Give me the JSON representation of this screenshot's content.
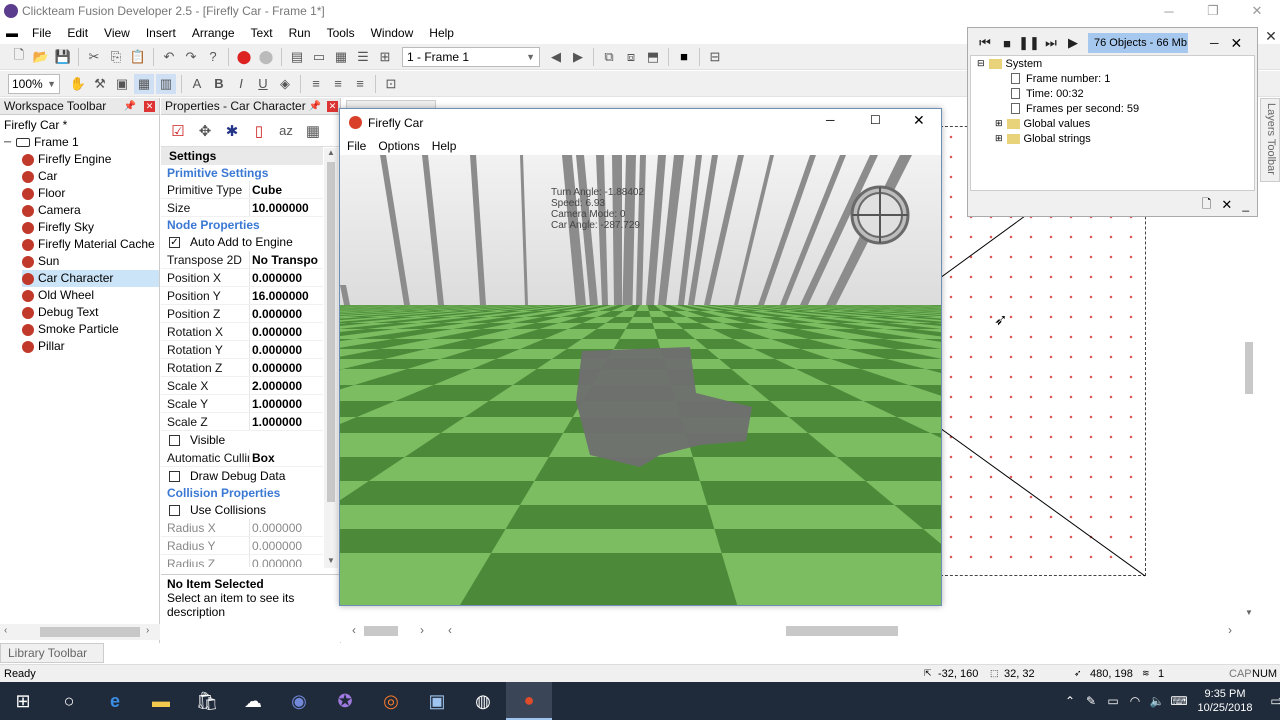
{
  "app": {
    "title": "Clickteam Fusion Developer 2.5 - [Firefly Car - Frame 1*]",
    "menu": [
      "File",
      "Edit",
      "View",
      "Insert",
      "Arrange",
      "Text",
      "Run",
      "Tools",
      "Window",
      "Help"
    ]
  },
  "toolbar": {
    "frame_select": "1 - Frame 1",
    "zoom": "100%"
  },
  "workspace": {
    "title": "Workspace Toolbar",
    "root": "Firefly Car *",
    "frame": "Frame 1",
    "items": [
      {
        "label": "Firefly Engine",
        "color": "#c0392b"
      },
      {
        "label": "Car",
        "color": "#c0392b"
      },
      {
        "label": "Floor",
        "color": "#c0392b"
      },
      {
        "label": "Camera",
        "color": "#c0392b"
      },
      {
        "label": "Firefly Sky",
        "color": "#c0392b"
      },
      {
        "label": "Firefly Material Cache",
        "color": "#c0392b"
      },
      {
        "label": "Sun",
        "color": "#c0392b"
      },
      {
        "label": "Car Character",
        "color": "#c0392b"
      },
      {
        "label": "Old Wheel",
        "color": "#c0392b"
      },
      {
        "label": "Debug Text",
        "color": "#c0392b"
      },
      {
        "label": "Smoke Particle",
        "color": "#c0392b"
      },
      {
        "label": "Pillar",
        "color": "#c0392b"
      }
    ],
    "selected_index": 7
  },
  "properties": {
    "title": "Properties - Car Character",
    "settings_tab": "Settings",
    "sec_primitive": "Primitive Settings",
    "primitive_type_label": "Primitive Type",
    "primitive_type": "Cube",
    "size_label": "Size",
    "size": "10.000000",
    "sec_node": "Node Properties",
    "auto_add": "Auto Add to Engine",
    "transpose_label": "Transpose 2D",
    "transpose": "No Transpo",
    "rows": [
      {
        "k": "Position X",
        "v": "0.000000"
      },
      {
        "k": "Position Y",
        "v": "16.000000"
      },
      {
        "k": "Position Z",
        "v": "0.000000"
      },
      {
        "k": "Rotation X",
        "v": "0.000000"
      },
      {
        "k": "Rotation Y",
        "v": "0.000000"
      },
      {
        "k": "Rotation Z",
        "v": "0.000000"
      },
      {
        "k": "Scale X",
        "v": "2.000000"
      },
      {
        "k": "Scale Y",
        "v": "1.000000"
      },
      {
        "k": "Scale Z",
        "v": "1.000000"
      }
    ],
    "visible": "Visible",
    "culling_label": "Automatic Cullin",
    "culling": "Box",
    "draw_debug": "Draw Debug Data",
    "sec_collision": "Collision Properties",
    "use_collisions": "Use Collisions",
    "dis_rows": [
      {
        "k": "Radius X",
        "v": "0.000000"
      },
      {
        "k": "Radius Y",
        "v": "0.000000"
      },
      {
        "k": "Radius Z",
        "v": "0.000000"
      },
      {
        "k": "Translation X",
        "v": "0.000000"
      }
    ],
    "info_title": "No Item Selected",
    "info_desc": "Select an item to see its description"
  },
  "game": {
    "title": "Firefly Car",
    "menu": [
      "File",
      "Options",
      "Help"
    ],
    "debug": [
      "Turn Angle: -1.88402",
      "Speed: 6.93",
      "Camera Mode: 0",
      "Car Angle: -287.729"
    ]
  },
  "debugger": {
    "status": "76 Objects - 66 Mb",
    "system": "System",
    "frame_number": "Frame number: 1",
    "time": "Time: 00:32",
    "fps": "Frames per second: 59",
    "global_values": "Global values",
    "global_strings": "Global strings"
  },
  "layers_toolbar": "Layers Toolbar",
  "library_toolbar": "Library Toolbar",
  "status": {
    "ready": "Ready",
    "coords1": "-32, 160",
    "coords2": "32, 32",
    "coords3": "480, 198",
    "layer": "1",
    "caps": "CAP",
    "num": "NUM"
  },
  "taskbar": {
    "time": "9:35 PM",
    "date": "10/25/2018",
    "notif": "1"
  }
}
